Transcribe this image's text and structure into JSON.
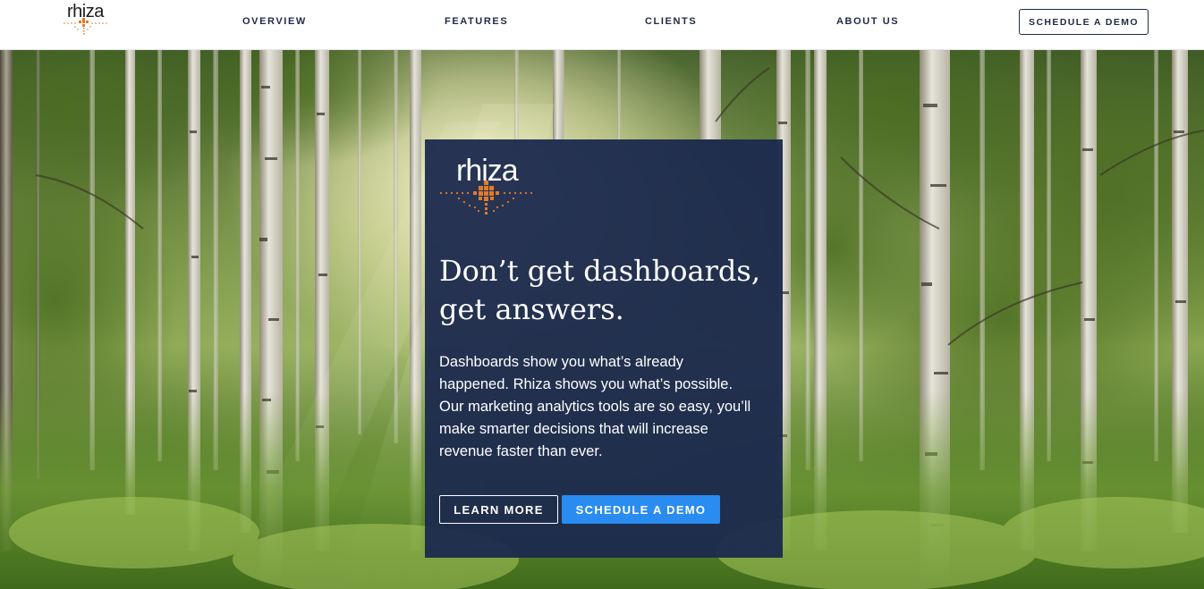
{
  "brand": {
    "name": "rhiza",
    "accent_color": "#e07b2a",
    "navy_color": "#1b294d",
    "button_blue": "#2a8cf0"
  },
  "nav": {
    "links": [
      {
        "label": "OVERVIEW"
      },
      {
        "label": "FEATURES"
      },
      {
        "label": "CLIENTS"
      },
      {
        "label": "ABOUT US"
      }
    ],
    "cta_label": "SCHEDULE A DEMO"
  },
  "hero": {
    "background": "sunlit birch forest photo",
    "card": {
      "logo_text": "rhiza",
      "headline_line1": "Don’t get dashboards,",
      "headline_line2": "get answers.",
      "body": "Dashboards show you what’s already happened. Rhiza shows you what’s possible. Our marketing analytics tools are so easy, you’ll make smarter decisions that will increase revenue faster than ever.",
      "learn_more_label": "LEARN MORE",
      "schedule_demo_label": "SCHEDULE A DEMO"
    }
  }
}
